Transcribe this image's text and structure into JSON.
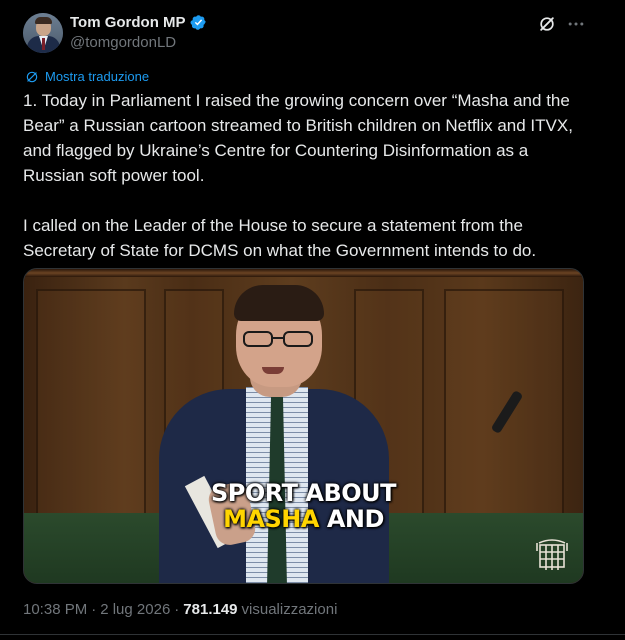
{
  "author": {
    "display_name": "Tom Gordon MP",
    "handle": "@tomgordonLD",
    "verified": true
  },
  "translate_label": "Mostra traduzione",
  "tweet": {
    "paragraph1": "1. Today in Parliament I raised the growing concern over “Masha and the Bear” a Russian cartoon streamed to British children on Netflix and ITVX, and flagged by Ukraine’s Centre for Countering Disinformation as a Russian soft power tool.",
    "paragraph2": "I called on the Leader of the House to secure a statement from the Secretary of State for DCMS on what the Government intends to do."
  },
  "video_caption": {
    "line1": "SPORT ABOUT",
    "line2_highlight": "MASHA",
    "line2_rest": "AND"
  },
  "meta": {
    "time": "10:38 PM",
    "separator": "·",
    "date": "2 lug 2026",
    "views_count": "781.149",
    "views_label": "visualizzazioni"
  },
  "icons": [
    "verified-badge-icon",
    "grok-icon",
    "more-icon",
    "translate-icon",
    "portcullis-icon"
  ],
  "colors": {
    "background": "#000000",
    "accent": "#1d9bf0",
    "secondary_text": "#71767b",
    "caption_highlight": "#ffd500"
  }
}
